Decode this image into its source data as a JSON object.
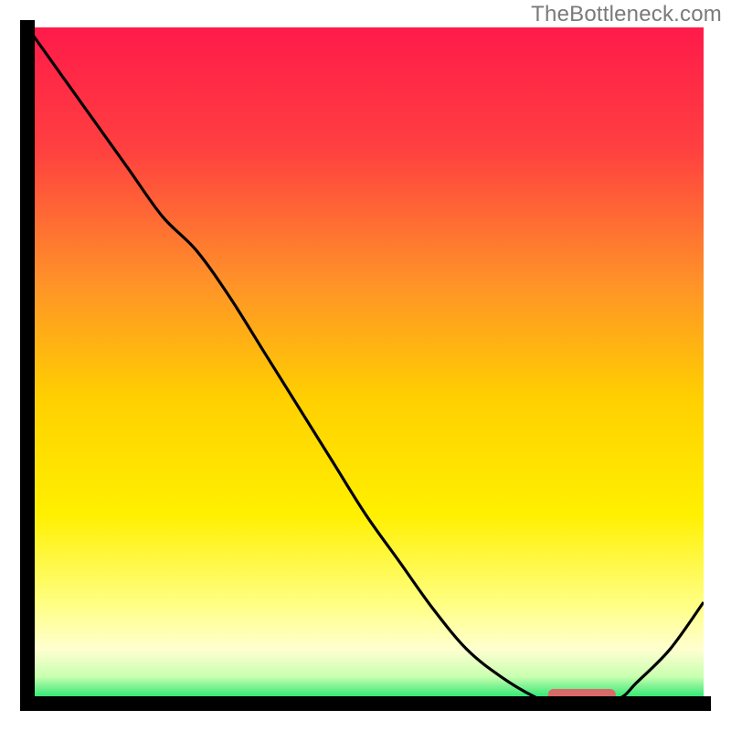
{
  "watermark": "TheBottleneck.com",
  "colors": {
    "gradient_top": "#ff1a4a",
    "gradient_mid1": "#ff7a2a",
    "gradient_mid2": "#ffd400",
    "gradient_mid3": "#ffff66",
    "gradient_mid4": "#ffffaa",
    "gradient_bottom": "#00e060",
    "axis": "#000000",
    "curve": "#000000",
    "marker_fill": "#d86a6a",
    "marker_stroke": "#b85050"
  },
  "chart_data": {
    "type": "line",
    "title": "",
    "xlabel": "",
    "ylabel": "",
    "x": [
      0.0,
      0.05,
      0.1,
      0.15,
      0.2,
      0.25,
      0.3,
      0.35,
      0.4,
      0.45,
      0.5,
      0.55,
      0.6,
      0.65,
      0.7,
      0.75,
      0.78,
      0.8,
      0.85,
      0.88,
      0.9,
      0.95,
      1.0
    ],
    "values": [
      1.0,
      0.93,
      0.86,
      0.79,
      0.72,
      0.67,
      0.6,
      0.52,
      0.44,
      0.36,
      0.28,
      0.21,
      0.14,
      0.08,
      0.04,
      0.01,
      0.0,
      0.0,
      0.0,
      0.01,
      0.03,
      0.08,
      0.15
    ],
    "xlim": [
      0,
      1
    ],
    "ylim": [
      0,
      1
    ],
    "marker_segment": {
      "x0": 0.77,
      "x1": 0.87,
      "y": 0.0
    }
  }
}
